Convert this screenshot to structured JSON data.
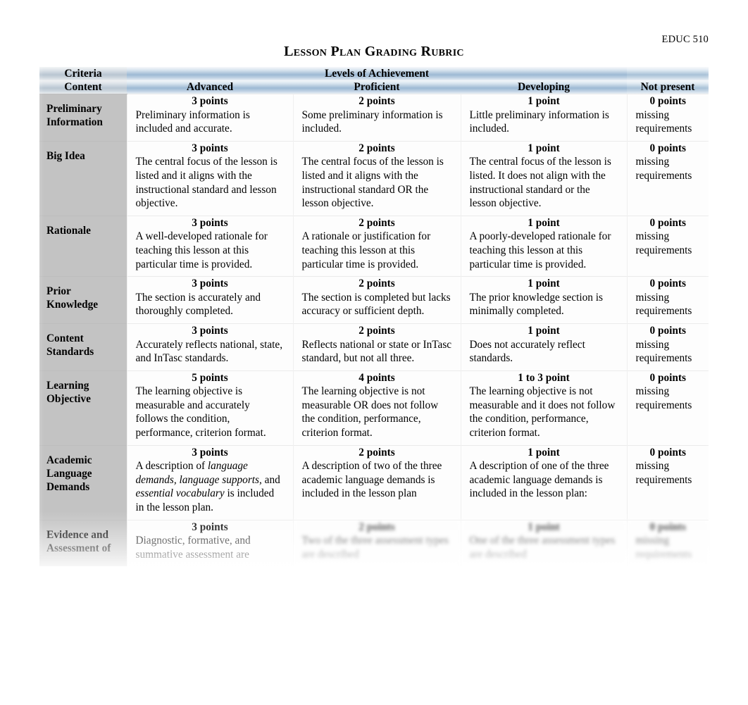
{
  "document": {
    "course_code": "EDUC 510",
    "title": "Lesson Plan Grading Rubric"
  },
  "table": {
    "header": {
      "criteria_top": "Criteria",
      "criteria_bottom": "Content",
      "levels_group": "Levels of Achievement",
      "levels": [
        "Advanced",
        "Proficient",
        "Developing",
        "Not present"
      ]
    },
    "rows": [
      {
        "criteria": "Preliminary Information",
        "criteria_line1": "Preliminary",
        "criteria_line2": "Information",
        "advanced": {
          "points": "3 points",
          "desc": "Preliminary information is included and accurate."
        },
        "proficient": {
          "points": "2 points",
          "desc": "Some preliminary information is included."
        },
        "developing": {
          "points": "1 point",
          "desc": "Little preliminary information is included."
        },
        "not_present": {
          "points": "0 points",
          "desc": "missing requirements"
        }
      },
      {
        "criteria": "Big Idea",
        "criteria_line1": "Big Idea",
        "criteria_line2": "",
        "advanced": {
          "points": "3 points",
          "desc": "The central focus of the lesson is listed and it aligns with the instructional standard and lesson objective."
        },
        "proficient": {
          "points": "2 points",
          "desc": "The central focus of the lesson is listed and it aligns with the instructional standard OR the lesson objective."
        },
        "developing": {
          "points": "1 point",
          "desc": "The central focus of the lesson is listed. It does not align with the instructional standard or the lesson objective."
        },
        "not_present": {
          "points": "0 points",
          "desc": "missing requirements"
        }
      },
      {
        "criteria": "Rationale",
        "criteria_line1": "Rationale",
        "criteria_line2": "",
        "advanced": {
          "points": "3 points",
          "desc": "A well-developed rationale for teaching this lesson at this particular time is provided."
        },
        "proficient": {
          "points": "2 points",
          "desc": "A rationale or justification for teaching this lesson at this particular time is provided."
        },
        "developing": {
          "points": "1 point",
          "desc": "A poorly-developed rationale for teaching this lesson at this particular time is provided."
        },
        "not_present": {
          "points": "0 points",
          "desc": "missing requirements"
        }
      },
      {
        "criteria": "Prior Knowledge",
        "criteria_line1": "Prior",
        "criteria_line2": "Knowledge",
        "advanced": {
          "points": "3 points",
          "desc": "The section is accurately and thoroughly completed."
        },
        "proficient": {
          "points": "2 points",
          "desc": "The section is completed but lacks accuracy or sufficient depth."
        },
        "developing": {
          "points": "1 point",
          "desc": "The prior knowledge section is minimally completed."
        },
        "not_present": {
          "points": "0 points",
          "desc": "missing requirements"
        }
      },
      {
        "criteria": "Content Standards",
        "criteria_line1": "Content",
        "criteria_line2": "Standards",
        "advanced": {
          "points": "3 points",
          "desc": "Accurately reflects national, state, and InTasc standards."
        },
        "proficient": {
          "points": "2 points",
          "desc": "Reflects national or state or InTasc standard, but not all three."
        },
        "developing": {
          "points": "1 point",
          "desc": "Does not accurately reflect standards."
        },
        "not_present": {
          "points": "0 points",
          "desc": "missing requirements"
        }
      },
      {
        "criteria": "Learning Objective",
        "criteria_line1": "Learning",
        "criteria_line2": "Objective",
        "advanced": {
          "points": "5 points",
          "desc": "The learning objective is measurable and accurately follows the condition, performance, criterion format."
        },
        "proficient": {
          "points": "4 points",
          "desc": "The learning objective is not measurable OR does not follow the condition, performance, criterion format."
        },
        "developing": {
          "points": "1 to 3 point",
          "desc": "The learning objective is not measurable and it does not follow the condition, performance, criterion format."
        },
        "not_present": {
          "points": "0 points",
          "desc": "missing requirements"
        }
      },
      {
        "criteria": "Academic Language Demands",
        "criteria_line1": "Academic",
        "criteria_line2": "Language",
        "criteria_line3": "Demands",
        "advanced": {
          "points": "3 points",
          "desc": "A description of language demands, language supports, and essential vocabulary is included in the lesson plan.",
          "desc_parts": [
            {
              "text": "A description of ",
              "italic": false
            },
            {
              "text": "language demands, language supports",
              "italic": true
            },
            {
              "text": ", and ",
              "italic": false
            },
            {
              "text": "essential vocabulary",
              "italic": true
            },
            {
              "text": " is included in the lesson plan.",
              "italic": false
            }
          ]
        },
        "proficient": {
          "points": "2 points",
          "desc": "A description of two of the three academic language demands is included in the lesson plan"
        },
        "developing": {
          "points": "1 point",
          "desc": "A description of one of the three academic language demands is included in the lesson plan:"
        },
        "not_present": {
          "points": "0 points",
          "desc": "missing requirements"
        }
      },
      {
        "criteria": "Evidence and Assessment of",
        "criteria_line1": "Evidence and",
        "criteria_line2": "Assessment of",
        "cut_off": true,
        "advanced": {
          "points": "3 points",
          "desc": "Diagnostic, formative, and summative assessment are"
        },
        "proficient": {
          "points": "2 points",
          "desc": "Two of the three assessment types are described"
        },
        "developing": {
          "points": "1 point",
          "desc": "One of the three assessment types are described"
        },
        "not_present": {
          "points": "0 points",
          "desc": "missing requirements"
        }
      }
    ]
  },
  "colors": {
    "header_blue": "#9db9d4",
    "criteria_gray": "#c3c3c3",
    "body_background": "#fdfdfd",
    "text": "#000000",
    "page_background": "#ffffff"
  }
}
